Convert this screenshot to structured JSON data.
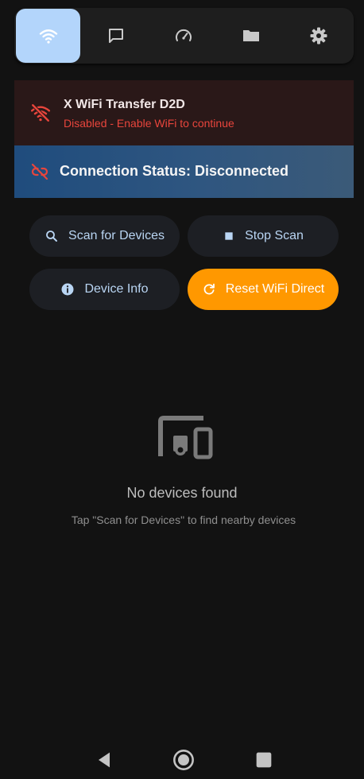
{
  "tabs": [
    {
      "icon": "wifi-icon",
      "active": true
    },
    {
      "icon": "chat-icon",
      "active": false
    },
    {
      "icon": "speed-gauge-icon",
      "active": false
    },
    {
      "icon": "folder-icon",
      "active": false
    },
    {
      "icon": "gear-icon",
      "active": false
    }
  ],
  "wifi_banner": {
    "title": "X WiFi Transfer D2D",
    "status": "Disabled - Enable WiFi to continue",
    "icon": "wifi-off-icon"
  },
  "connection": {
    "label": "Connection Status: Disconnected",
    "icon": "link-off-icon"
  },
  "actions": {
    "scan": "Scan for Devices",
    "stop": "Stop Scan",
    "info": "Device Info",
    "reset": "Reset WiFi Direct"
  },
  "empty_state": {
    "icon": "devices-icon",
    "title": "No devices found",
    "hint": "Tap \"Scan for Devices\" to find nearby devices"
  },
  "system_nav": [
    "back-icon",
    "home-icon",
    "recents-icon"
  ],
  "colors": {
    "accent_blue": "#b3d5fb",
    "warning_red": "#e8453c",
    "reset_orange": "#ff9800",
    "background": "#121212"
  }
}
